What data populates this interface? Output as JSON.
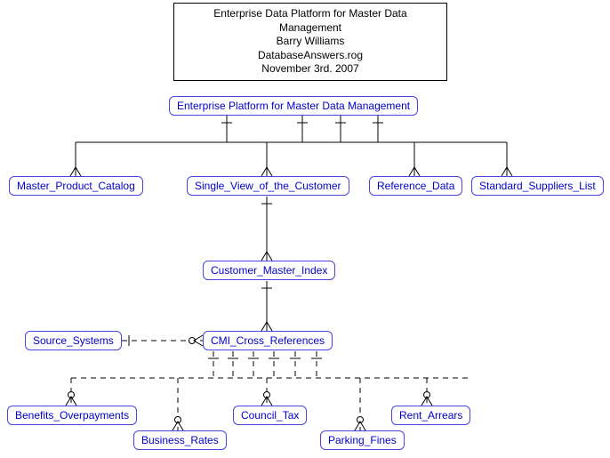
{
  "title_box": {
    "line1": "Enterprise Data Platform for Master Data Management",
    "line2": "Barry Williams",
    "line3": "DatabaseAnswers.rog",
    "line4": "November 3rd. 2007"
  },
  "entities": {
    "root": "Enterprise Platform for Master Data Management",
    "master_product_catalog": "Master_Product_Catalog",
    "single_view_customer": "Single_View_of_the_Customer",
    "reference_data": "Reference_Data",
    "standard_suppliers": "Standard_Suppliers_List",
    "customer_master_index": "Customer_Master_Index",
    "source_systems": "Source_Systems",
    "cmi_cross_references": "CMI_Cross_References",
    "benefits_overpayments": "Benefits_Overpayments",
    "business_rates": "Business_Rates",
    "council_tax": "Council_Tax",
    "parking_fines": "Parking_Fines",
    "rent_arrears": "Rent_Arrears"
  }
}
